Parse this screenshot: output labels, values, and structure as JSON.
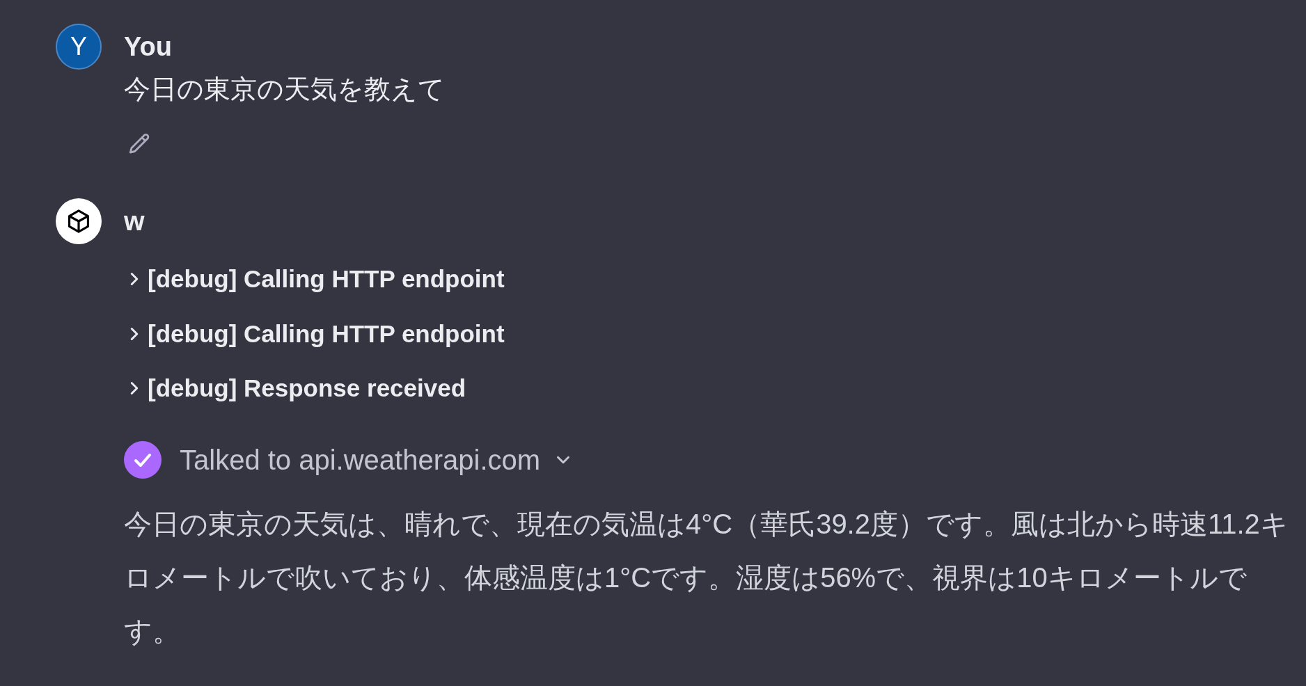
{
  "messages": [
    {
      "kind": "user",
      "avatar_letter": "Y",
      "author": "You",
      "text": "今日の東京の天気を教えて"
    },
    {
      "kind": "assistant",
      "author": "w",
      "debug_items": [
        {
          "label": "[debug] Calling HTTP endpoint",
          "expanded": false
        },
        {
          "label": "[debug] Calling HTTP endpoint",
          "expanded": false
        },
        {
          "label": "[debug] Response received",
          "expanded": false
        }
      ],
      "tool_call": {
        "label": "Talked to api.weatherapi.com",
        "done": true,
        "expanded": false
      },
      "text": "今日の東京の天気は、晴れで、現在の気温は4°C（華氏39.2度）です。風は北から時速11.2キロメートルで吹いており、体感温度は1°Cです。湿度は56%で、視界は10キロメートルです。"
    }
  ]
}
